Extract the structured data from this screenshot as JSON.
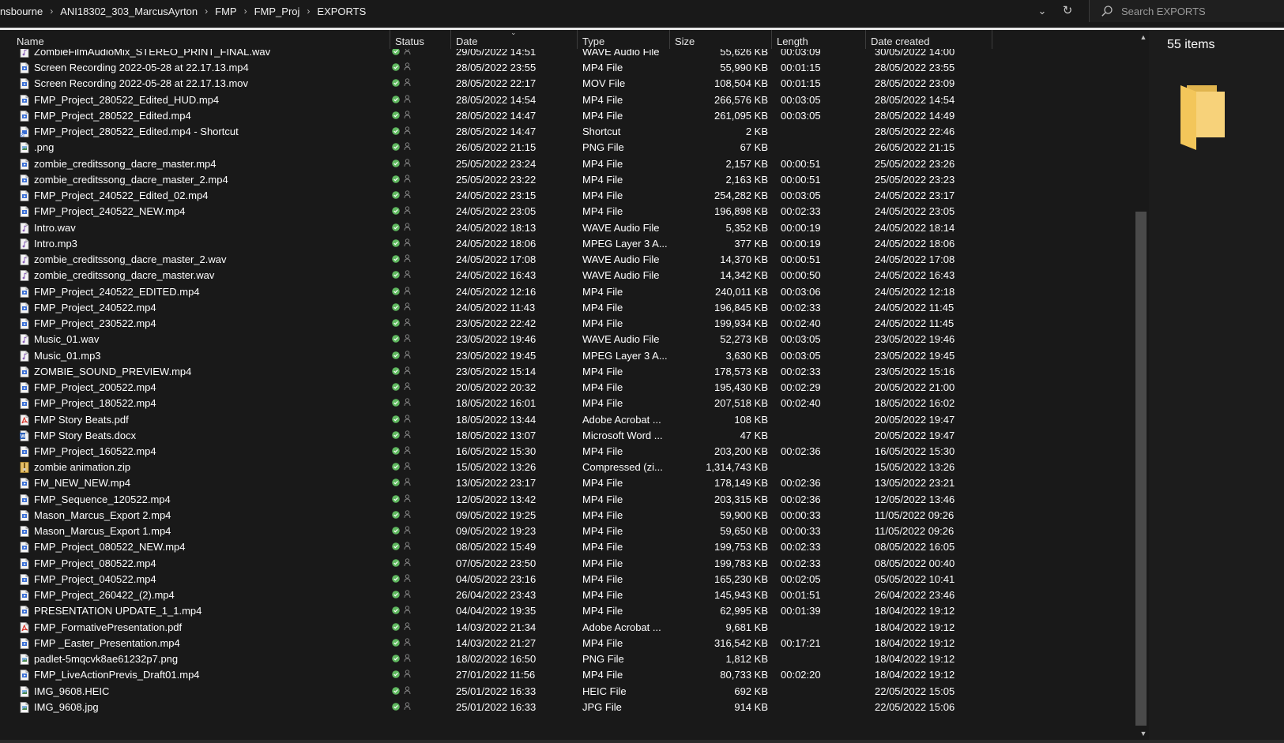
{
  "breadcrumb": [
    {
      "label": "nsbourne"
    },
    {
      "label": "ANI18302_303_MarcusAyrton"
    },
    {
      "label": "FMP"
    },
    {
      "label": "FMP_Proj"
    },
    {
      "label": "EXPORTS"
    }
  ],
  "address": {
    "dropdown_icon": "chevron-down-icon",
    "refresh_icon": "refresh-icon"
  },
  "search": {
    "placeholder": "Search EXPORTS",
    "value": ""
  },
  "columns": {
    "name": "Name",
    "status": "Status",
    "date": "Date",
    "type": "Type",
    "size": "Size",
    "length": "Length",
    "created": "Date created"
  },
  "details": {
    "items_count": "55 items"
  },
  "colors": {
    "background": "#191919",
    "sync_ok": "#5fb85f",
    "mp4_icon": "#3a6fd6",
    "pdf_icon": "#d93025",
    "word_icon": "#2b5fb8",
    "zip_icon": "#e8c26a",
    "folder": "#f3c65a"
  },
  "files": [
    {
      "name": "ZombieFilmAudioMix_STEREO_PRINT_FINAL.wav",
      "date": "29/05/2022 14:51",
      "type": "WAVE Audio File",
      "size": "55,626 KB",
      "length": "00:03:09",
      "created": "30/05/2022 14:00",
      "icon": "wav"
    },
    {
      "name": "Screen Recording 2022-05-28 at 22.17.13.mp4",
      "date": "28/05/2022 23:55",
      "type": "MP4 File",
      "size": "55,990 KB",
      "length": "00:01:15",
      "created": "28/05/2022 23:55",
      "icon": "mp4"
    },
    {
      "name": "Screen Recording 2022-05-28 at 22.17.13.mov",
      "date": "28/05/2022 22:17",
      "type": "MOV File",
      "size": "108,504 KB",
      "length": "00:01:15",
      "created": "28/05/2022 23:09",
      "icon": "mp4"
    },
    {
      "name": "FMP_Project_280522_Edited_HUD.mp4",
      "date": "28/05/2022 14:54",
      "type": "MP4 File",
      "size": "266,576 KB",
      "length": "00:03:05",
      "created": "28/05/2022 14:54",
      "icon": "mp4"
    },
    {
      "name": "FMP_Project_280522_Edited.mp4",
      "date": "28/05/2022 14:47",
      "type": "MP4 File",
      "size": "261,095 KB",
      "length": "00:03:05",
      "created": "28/05/2022 14:49",
      "icon": "mp4"
    },
    {
      "name": "FMP_Project_280522_Edited.mp4 - Shortcut",
      "date": "28/05/2022 14:47",
      "type": "Shortcut",
      "size": "2 KB",
      "length": "",
      "created": "28/05/2022 22:46",
      "icon": "shortcut"
    },
    {
      "name": ".png",
      "date": "26/05/2022 21:15",
      "type": "PNG File",
      "size": "67 KB",
      "length": "",
      "created": "26/05/2022 21:15",
      "icon": "image"
    },
    {
      "name": "zombie_creditssong_dacre_master.mp4",
      "date": "25/05/2022 23:24",
      "type": "MP4 File",
      "size": "2,157 KB",
      "length": "00:00:51",
      "created": "25/05/2022 23:26",
      "icon": "mp4"
    },
    {
      "name": "zombie_creditssong_dacre_master_2.mp4",
      "date": "25/05/2022 23:22",
      "type": "MP4 File",
      "size": "2,163 KB",
      "length": "00:00:51",
      "created": "25/05/2022 23:23",
      "icon": "mp4"
    },
    {
      "name": "FMP_Project_240522_Edited_02.mp4",
      "date": "24/05/2022 23:15",
      "type": "MP4 File",
      "size": "254,282 KB",
      "length": "00:03:05",
      "created": "24/05/2022 23:17",
      "icon": "mp4"
    },
    {
      "name": "FMP_Project_240522_NEW.mp4",
      "date": "24/05/2022 23:05",
      "type": "MP4 File",
      "size": "196,898 KB",
      "length": "00:02:33",
      "created": "24/05/2022 23:05",
      "icon": "mp4"
    },
    {
      "name": "Intro.wav",
      "date": "24/05/2022 18:13",
      "type": "WAVE Audio File",
      "size": "5,352 KB",
      "length": "00:00:19",
      "created": "24/05/2022 18:14",
      "icon": "wav"
    },
    {
      "name": "Intro.mp3",
      "date": "24/05/2022 18:06",
      "type": "MPEG Layer 3 A...",
      "size": "377 KB",
      "length": "00:00:19",
      "created": "24/05/2022 18:06",
      "icon": "wav"
    },
    {
      "name": "zombie_creditssong_dacre_master_2.wav",
      "date": "24/05/2022 17:08",
      "type": "WAVE Audio File",
      "size": "14,370 KB",
      "length": "00:00:51",
      "created": "24/05/2022 17:08",
      "icon": "wav"
    },
    {
      "name": "zombie_creditssong_dacre_master.wav",
      "date": "24/05/2022 16:43",
      "type": "WAVE Audio File",
      "size": "14,342 KB",
      "length": "00:00:50",
      "created": "24/05/2022 16:43",
      "icon": "wav"
    },
    {
      "name": "FMP_Project_240522_EDITED.mp4",
      "date": "24/05/2022 12:16",
      "type": "MP4 File",
      "size": "240,011 KB",
      "length": "00:03:06",
      "created": "24/05/2022 12:18",
      "icon": "mp4"
    },
    {
      "name": "FMP_Project_240522.mp4",
      "date": "24/05/2022 11:43",
      "type": "MP4 File",
      "size": "196,845 KB",
      "length": "00:02:33",
      "created": "24/05/2022 11:45",
      "icon": "mp4"
    },
    {
      "name": "FMP_Project_230522.mp4",
      "date": "23/05/2022 22:42",
      "type": "MP4 File",
      "size": "199,934 KB",
      "length": "00:02:40",
      "created": "24/05/2022 11:45",
      "icon": "mp4"
    },
    {
      "name": "Music_01.wav",
      "date": "23/05/2022 19:46",
      "type": "WAVE Audio File",
      "size": "52,273 KB",
      "length": "00:03:05",
      "created": "23/05/2022 19:46",
      "icon": "wav"
    },
    {
      "name": "Music_01.mp3",
      "date": "23/05/2022 19:45",
      "type": "MPEG Layer 3 A...",
      "size": "3,630 KB",
      "length": "00:03:05",
      "created": "23/05/2022 19:45",
      "icon": "wav"
    },
    {
      "name": "ZOMBIE_SOUND_PREVIEW.mp4",
      "date": "23/05/2022 15:14",
      "type": "MP4 File",
      "size": "178,573 KB",
      "length": "00:02:33",
      "created": "23/05/2022 15:16",
      "icon": "mp4"
    },
    {
      "name": "FMP_Project_200522.mp4",
      "date": "20/05/2022 20:32",
      "type": "MP4 File",
      "size": "195,430 KB",
      "length": "00:02:29",
      "created": "20/05/2022 21:00",
      "icon": "mp4"
    },
    {
      "name": "FMP_Project_180522.mp4",
      "date": "18/05/2022 16:01",
      "type": "MP4 File",
      "size": "207,518 KB",
      "length": "00:02:40",
      "created": "18/05/2022 16:02",
      "icon": "mp4"
    },
    {
      "name": "FMP Story Beats.pdf",
      "date": "18/05/2022 13:44",
      "type": "Adobe Acrobat ...",
      "size": "108 KB",
      "length": "",
      "created": "20/05/2022 19:47",
      "icon": "pdf"
    },
    {
      "name": "FMP Story Beats.docx",
      "date": "18/05/2022 13:07",
      "type": "Microsoft Word ...",
      "size": "47 KB",
      "length": "",
      "created": "20/05/2022 19:47",
      "icon": "word"
    },
    {
      "name": "FMP_Project_160522.mp4",
      "date": "16/05/2022 15:30",
      "type": "MP4 File",
      "size": "203,200 KB",
      "length": "00:02:36",
      "created": "16/05/2022 15:30",
      "icon": "mp4"
    },
    {
      "name": "zombie animation.zip",
      "date": "15/05/2022 13:26",
      "type": "Compressed (zi...",
      "size": "1,314,743 KB",
      "length": "",
      "created": "15/05/2022 13:26",
      "icon": "zip"
    },
    {
      "name": "FM_NEW_NEW.mp4",
      "date": "13/05/2022 23:17",
      "type": "MP4 File",
      "size": "178,149 KB",
      "length": "00:02:36",
      "created": "13/05/2022 23:21",
      "icon": "mp4"
    },
    {
      "name": "FMP_Sequence_120522.mp4",
      "date": "12/05/2022 13:42",
      "type": "MP4 File",
      "size": "203,315 KB",
      "length": "00:02:36",
      "created": "12/05/2022 13:46",
      "icon": "mp4"
    },
    {
      "name": "Mason_Marcus_Export 2.mp4",
      "date": "09/05/2022 19:25",
      "type": "MP4 File",
      "size": "59,900 KB",
      "length": "00:00:33",
      "created": "11/05/2022 09:26",
      "icon": "mp4"
    },
    {
      "name": "Mason_Marcus_Export 1.mp4",
      "date": "09/05/2022 19:23",
      "type": "MP4 File",
      "size": "59,650 KB",
      "length": "00:00:33",
      "created": "11/05/2022 09:26",
      "icon": "mp4"
    },
    {
      "name": "FMP_Project_080522_NEW.mp4",
      "date": "08/05/2022 15:49",
      "type": "MP4 File",
      "size": "199,753 KB",
      "length": "00:02:33",
      "created": "08/05/2022 16:05",
      "icon": "mp4"
    },
    {
      "name": "FMP_Project_080522.mp4",
      "date": "07/05/2022 23:50",
      "type": "MP4 File",
      "size": "199,783 KB",
      "length": "00:02:33",
      "created": "08/05/2022 00:40",
      "icon": "mp4"
    },
    {
      "name": "FMP_Project_040522.mp4",
      "date": "04/05/2022 23:16",
      "type": "MP4 File",
      "size": "165,230 KB",
      "length": "00:02:05",
      "created": "05/05/2022 10:41",
      "icon": "mp4"
    },
    {
      "name": "FMP_Project_260422_(2).mp4",
      "date": "26/04/2022 23:43",
      "type": "MP4 File",
      "size": "145,943 KB",
      "length": "00:01:51",
      "created": "26/04/2022 23:46",
      "icon": "mp4"
    },
    {
      "name": "PRESENTATION UPDATE_1_1.mp4",
      "date": "04/04/2022 19:35",
      "type": "MP4 File",
      "size": "62,995 KB",
      "length": "00:01:39",
      "created": "18/04/2022 19:12",
      "icon": "mp4"
    },
    {
      "name": "FMP_FormativePresentation.pdf",
      "date": "14/03/2022 21:34",
      "type": "Adobe Acrobat ...",
      "size": "9,681 KB",
      "length": "",
      "created": "18/04/2022 19:12",
      "icon": "pdf"
    },
    {
      "name": "FMP _Easter_Presentation.mp4",
      "date": "14/03/2022 21:27",
      "type": "MP4 File",
      "size": "316,542 KB",
      "length": "00:17:21",
      "created": "18/04/2022 19:12",
      "icon": "mp4"
    },
    {
      "name": "padlet-5mqcvk8ae61232p7.png",
      "date": "18/02/2022 16:50",
      "type": "PNG File",
      "size": "1,812 KB",
      "length": "",
      "created": "18/04/2022 19:12",
      "icon": "image"
    },
    {
      "name": "FMP_LiveActionPrevis_Draft01.mp4",
      "date": "27/01/2022 11:56",
      "type": "MP4 File",
      "size": "80,733 KB",
      "length": "00:02:20",
      "created": "18/04/2022 19:12",
      "icon": "mp4"
    },
    {
      "name": "IMG_9608.HEIC",
      "date": "25/01/2022 16:33",
      "type": "HEIC File",
      "size": "692 KB",
      "length": "",
      "created": "22/05/2022 15:05",
      "icon": "image"
    },
    {
      "name": "IMG_9608.jpg",
      "date": "25/01/2022 16:33",
      "type": "JPG File",
      "size": "914 KB",
      "length": "",
      "created": "22/05/2022 15:06",
      "icon": "image"
    }
  ]
}
